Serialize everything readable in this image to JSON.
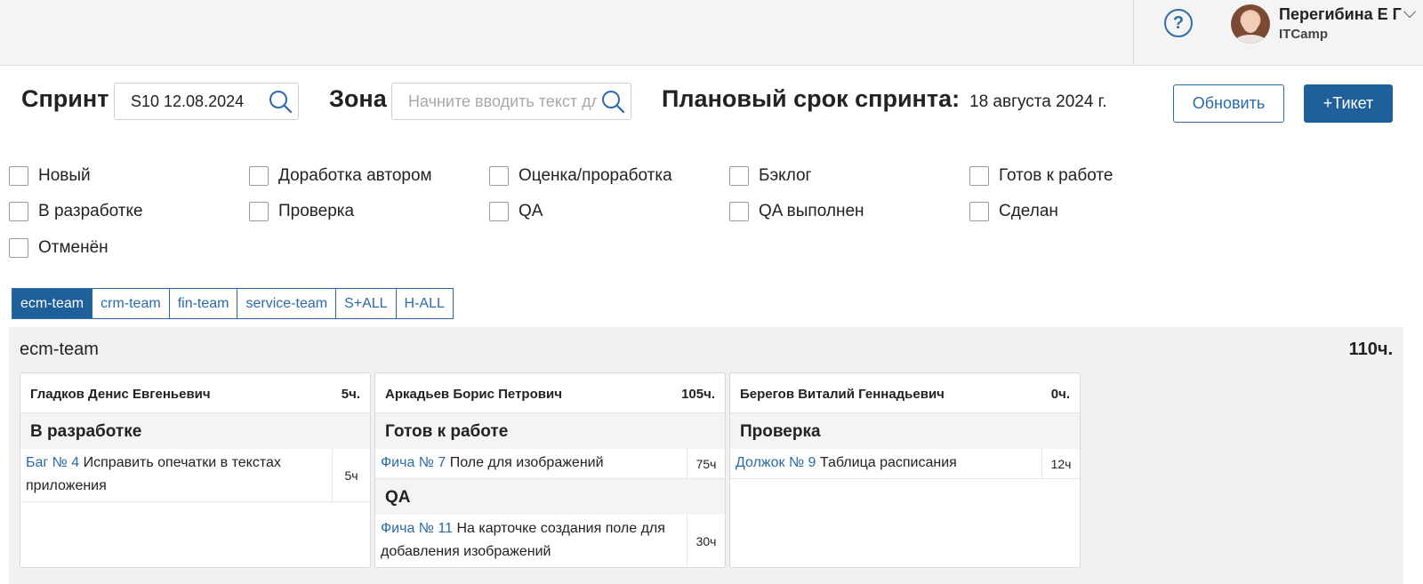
{
  "header": {
    "help_label": "?",
    "user_name": "Перегибина Е Г",
    "user_org": "ITCamp"
  },
  "toolbar": {
    "sprint_label": "Спринт",
    "sprint_value": "S10 12.08.2024",
    "zone_label": "Зона",
    "zone_placeholder": "Начните вводить текст для поиска",
    "planned_label": "Плановый срок спринта:",
    "planned_date": "18 августа 2024 г.",
    "refresh_label": "Обновить",
    "add_ticket_label": "+Тикет"
  },
  "filters": [
    {
      "label": "Новый",
      "checked": false
    },
    {
      "label": "Доработка автором",
      "checked": false
    },
    {
      "label": "Оценка/проработка",
      "checked": false
    },
    {
      "label": "Бэклог",
      "checked": false
    },
    {
      "label": "Готов к работе",
      "checked": false
    },
    {
      "label": "В разработке",
      "checked": false
    },
    {
      "label": "Проверка",
      "checked": false
    },
    {
      "label": "QA",
      "checked": false
    },
    {
      "label": "QA выполнен",
      "checked": false
    },
    {
      "label": "Сделан",
      "checked": false
    },
    {
      "label": "Отменён",
      "checked": false
    }
  ],
  "team_tabs": [
    {
      "label": "ecm-team",
      "active": true
    },
    {
      "label": "crm-team",
      "active": false
    },
    {
      "label": "fin-team",
      "active": false
    },
    {
      "label": "service-team",
      "active": false
    },
    {
      "label": "S+ALL",
      "active": false
    },
    {
      "label": "H-ALL",
      "active": false
    }
  ],
  "board": {
    "title": "ecm-team",
    "total_hours": "110ч.",
    "cards": [
      {
        "name": "Гладков Денис Евгеньевич",
        "hours": "5ч.",
        "groups": [
          {
            "status": "В разработке",
            "tasks": [
              {
                "link": "Баг № 4",
                "text": "Исправить опечатки в текстах приложения",
                "hours": "5ч"
              }
            ]
          }
        ]
      },
      {
        "name": "Аркадьев Борис Петрович",
        "hours": "105ч.",
        "groups": [
          {
            "status": "Готов к работе",
            "tasks": [
              {
                "link": "Фича № 7",
                "text": "Поле для изображений",
                "hours": "75ч"
              }
            ]
          },
          {
            "status": "QA",
            "tasks": [
              {
                "link": "Фича № 11",
                "text": "На карточке создания поле для добавления изображений",
                "hours": "30ч"
              }
            ]
          }
        ]
      },
      {
        "name": "Берегов Виталий Геннадьевич",
        "hours": "0ч.",
        "groups": [
          {
            "status": "Проверка",
            "tasks": [
              {
                "link": "Должок № 9",
                "text": "Таблица расписания",
                "hours": "12ч"
              }
            ]
          }
        ]
      }
    ]
  }
}
